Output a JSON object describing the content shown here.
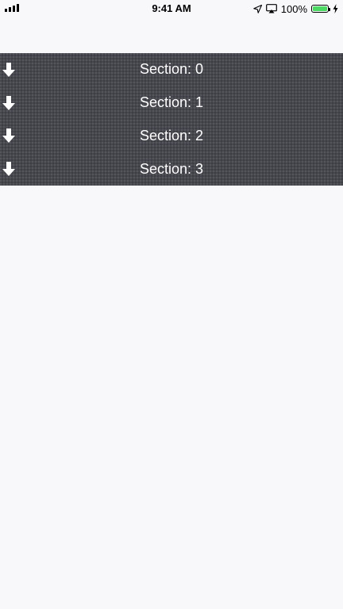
{
  "status_bar": {
    "time": "9:41 AM",
    "battery_percent": "100%",
    "signal_bars": 4,
    "battery_color": "#4cd964"
  },
  "sections": {
    "background_color": "#47474f",
    "icon": "arrow-down-icon",
    "items": [
      {
        "label": "Section: 0"
      },
      {
        "label": "Section: 1"
      },
      {
        "label": "Section: 2"
      },
      {
        "label": "Section: 3"
      }
    ]
  }
}
